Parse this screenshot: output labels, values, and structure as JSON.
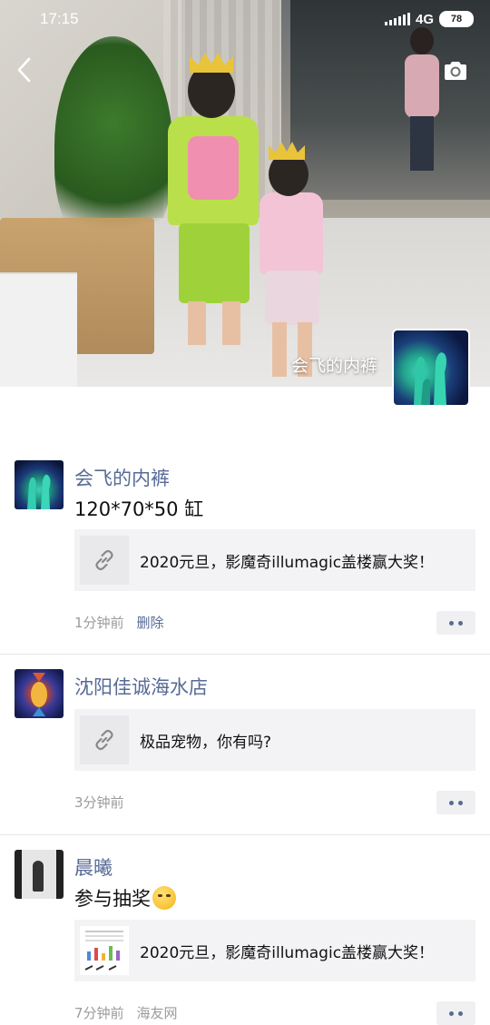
{
  "status_bar": {
    "time": "17:15",
    "network": "4G",
    "battery": "78"
  },
  "cover": {
    "owner_name": "会飞的内裤"
  },
  "icons": {
    "back": "chevron-left-icon",
    "camera": "camera-icon",
    "link": "link-icon",
    "more": "more-dots-icon"
  },
  "colors": {
    "name_blue": "#576b95",
    "meta_gray": "#9b9b9b",
    "card_bg": "#f3f3f5"
  },
  "posts": [
    {
      "author": "会飞的内裤",
      "text": "120*70*50 缸",
      "link_title": "2020元旦，影魔奇illumagic盖楼赢大奖！",
      "time": "1分钟前",
      "action": "删除"
    },
    {
      "author": "沈阳佳诚海水店",
      "text": "",
      "link_title": "极品宠物，你有吗?",
      "time": "3分钟前"
    },
    {
      "author": "晨曦",
      "text": "参与抽奖",
      "link_title": "2020元旦，影魔奇illumagic盖楼赢大奖！",
      "time": "7分钟前",
      "source": "海友网"
    }
  ]
}
